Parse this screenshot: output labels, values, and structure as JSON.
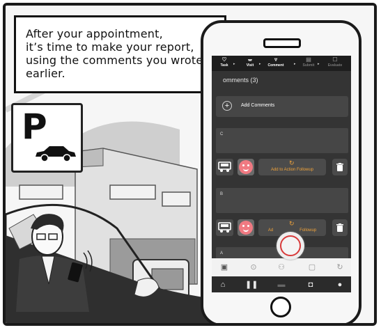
{
  "caption": {
    "lines": [
      "After your appointment,",
      "it’s time to make your report,",
      "using the comments you wrote",
      "earlier."
    ]
  },
  "parking_sign": {
    "letter": "P",
    "icon": "car-icon"
  },
  "app": {
    "steps": [
      {
        "label": "Task",
        "icon": "task-icon",
        "state": "done"
      },
      {
        "label": "Visit",
        "icon": "walk-icon",
        "state": "done"
      },
      {
        "label": "Comment",
        "icon": "comment-icon",
        "state": "current"
      },
      {
        "label": "Submit",
        "icon": "submit-icon",
        "state": "upcoming"
      },
      {
        "label": "Evaluate",
        "icon": "evaluate-icon",
        "state": "upcoming"
      }
    ],
    "comments_header": "omments (3)",
    "add_comments": "Add Comments",
    "cards": [
      {
        "label": "C",
        "followup": "Add to Action Followup"
      },
      {
        "label": "B",
        "followup": "Followup",
        "followup_prefix": "Ad"
      },
      {
        "label": "A"
      }
    ],
    "tabs": [
      "calendar-check-icon",
      "map-pin-icon",
      "people-icon",
      "document-icon",
      "history-icon"
    ],
    "nav": [
      "home-icon",
      "footsteps-icon",
      "chat-icon",
      "briefcase-icon",
      "profile-icon"
    ],
    "colors": {
      "accent": "#f0a33b",
      "record": "#d83a3a",
      "screen": "#343434"
    }
  }
}
